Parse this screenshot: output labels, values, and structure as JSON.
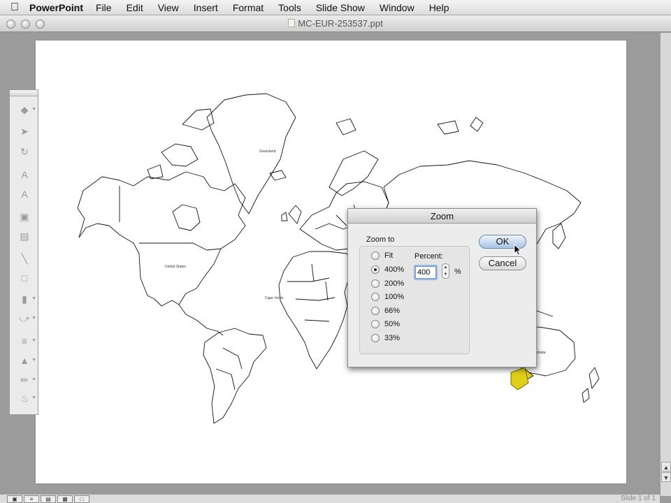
{
  "menubar": {
    "app_name": "PowerPoint",
    "items": [
      "File",
      "Edit",
      "View",
      "Insert",
      "Format",
      "Tools",
      "Slide Show",
      "Window",
      "Help"
    ]
  },
  "window": {
    "title": "MC-EUR-253537.ppt"
  },
  "slide": {
    "map_labels": [
      "Greenland",
      "United States",
      "Cape Verde",
      "Australia"
    ]
  },
  "status": {
    "slide_count": "Slide 1 of 1"
  },
  "zoom_dialog": {
    "title": "Zoom",
    "group_label": "Zoom to",
    "options": [
      "Fit",
      "400%",
      "200%",
      "100%",
      "66%",
      "50%",
      "33%"
    ],
    "selected_option": "400%",
    "percent_label": "Percent:",
    "percent_value": "400",
    "percent_unit": "%",
    "ok_label": "OK",
    "cancel_label": "Cancel"
  },
  "colors": {
    "highlight_country": "#e0cf17",
    "selection_blue": "#7ea4d6"
  }
}
